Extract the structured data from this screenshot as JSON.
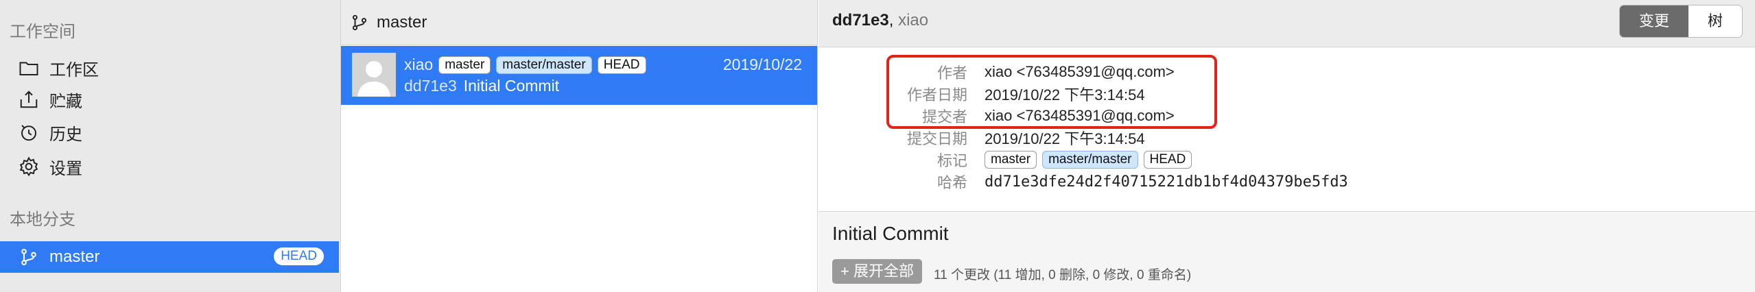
{
  "sidebar": {
    "workspace_title": "工作空间",
    "items": [
      {
        "label": "工作区",
        "icon": "folder-icon"
      },
      {
        "label": "贮藏",
        "icon": "stash-icon"
      },
      {
        "label": "历史",
        "icon": "history-icon"
      },
      {
        "label": "设置",
        "icon": "gear-icon"
      }
    ],
    "branches_title": "本地分支",
    "branch": {
      "name": "master",
      "badge": "HEAD",
      "icon": "branch-icon"
    }
  },
  "commit_list": {
    "header": "master",
    "commits": [
      {
        "author": "xiao",
        "tags": [
          "master",
          "master/master",
          "HEAD"
        ],
        "date": "2019/10/22",
        "sha": "dd71e3",
        "message": "Initial Commit"
      }
    ]
  },
  "detail": {
    "header_sha": "dd71e3",
    "header_sep": ",",
    "header_author": "xiao",
    "tabs": [
      "变更",
      "树"
    ],
    "active_tab": "变更",
    "fields": {
      "author_label": "作者",
      "author_value": "xiao <763485391@qq.com>",
      "author_date_label": "作者日期",
      "author_date_value": "2019/10/22 下午3:14:54",
      "committer_label": "提交者",
      "committer_value": "xiao <763485391@qq.com>",
      "commit_date_label": "提交日期",
      "commit_date_value": "2019/10/22 下午3:14:54",
      "tags_label": "标记",
      "tags": [
        "master",
        "master/master",
        "HEAD"
      ],
      "hash_label": "哈希",
      "hash_value": "dd71e3dfe24d2f40715221db1bf4d04379be5fd3"
    },
    "message": "Initial Commit",
    "expand_label": "+ 展开全部",
    "summary": "11 个更改 (11 增加, 0 删除, 0 修改, 0 重命名)"
  },
  "colors": {
    "accent": "#2f7bf5",
    "highlight": "#e3221c",
    "sidebar_bg": "#e9e9e9"
  }
}
